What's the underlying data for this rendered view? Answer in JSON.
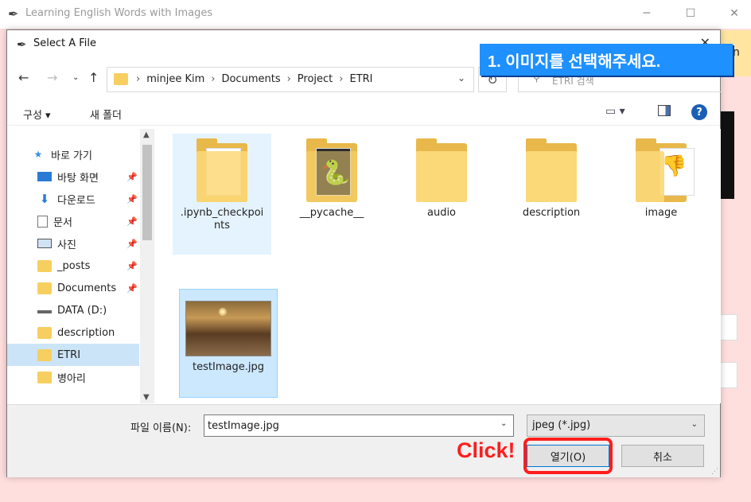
{
  "app": {
    "title": "Learning English Words with Images",
    "bg_right_text": "n"
  },
  "dialog": {
    "title": "Select A File",
    "breadcrumbs": [
      "minjee Kim",
      "Documents",
      "Project",
      "ETRI"
    ],
    "search_placeholder": "ETRI 검색",
    "toolbar": {
      "organize": "구성 ▾",
      "new_folder": "새 폴더"
    },
    "sidebar": [
      {
        "label": "바로 가기",
        "icon": "star-icon"
      },
      {
        "label": "바탕 화면",
        "icon": "desktop-icon"
      },
      {
        "label": "다운로드",
        "icon": "download-icon"
      },
      {
        "label": "문서",
        "icon": "document-icon"
      },
      {
        "label": "사진",
        "icon": "picture-icon"
      },
      {
        "label": "_posts",
        "icon": "folder-icon"
      },
      {
        "label": "Documents",
        "icon": "folder-icon"
      },
      {
        "label": "DATA (D:)",
        "icon": "drive-icon"
      },
      {
        "label": "description",
        "icon": "folder-icon"
      },
      {
        "label": "ETRI",
        "icon": "folder-icon"
      },
      {
        "label": "병아리",
        "icon": "folder-icon"
      }
    ],
    "files": [
      {
        "name": ".ipynb_checkpoi\nnts",
        "l1": ".ipynb_checkpoi",
        "l2": "nts"
      },
      {
        "name": "__pycache__"
      },
      {
        "name": "audio"
      },
      {
        "name": "description"
      },
      {
        "name": "image"
      },
      {
        "name": "testImage.jpg"
      }
    ],
    "filename_label": "파일 이름(N):",
    "filename_value": "testImage.jpg",
    "filetype_value": "jpeg (*.jpg)",
    "open_label": "열기(O)",
    "cancel_label": "취소"
  },
  "annotations": {
    "banner": "1. 이미지를 선택해주세요.",
    "click": "Click!"
  },
  "colors": {
    "accent": "#1e90ff",
    "highlight": "#ff1d1d",
    "app_bg": "#ffdede"
  }
}
